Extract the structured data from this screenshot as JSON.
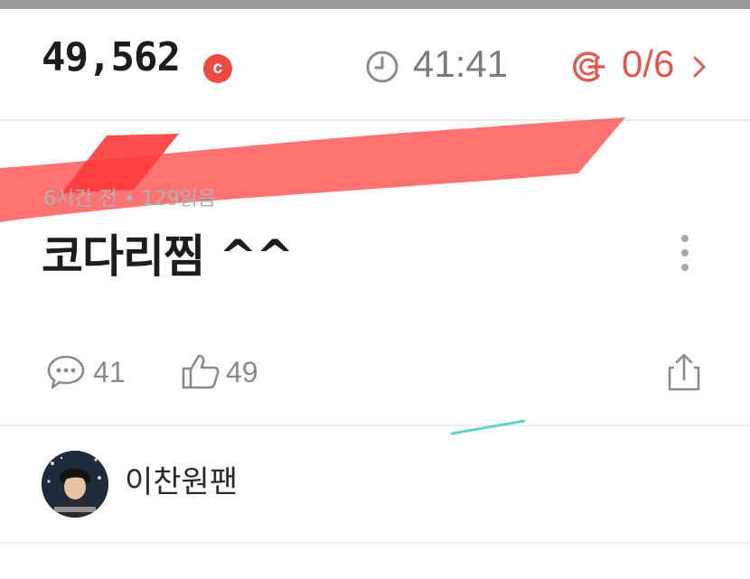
{
  "header": {
    "coin_balance": "49,562",
    "coin_badge_letter": "c",
    "timer": "41:41",
    "quota": "0/6",
    "icons": [
      "coin-icon",
      "clock-icon",
      "coin-plus-icon",
      "chevron-right-icon"
    ]
  },
  "post": {
    "meta": "6시간 전 • 129읽음",
    "title": "코다리찜 ^^",
    "comment_count": "41",
    "like_count": "49",
    "icons": [
      "more-vertical-icon",
      "comment-icon",
      "thumbs-up-icon",
      "share-icon"
    ]
  },
  "author": {
    "name": "이찬원팬"
  },
  "colors": {
    "accent_red": "#ea4b43",
    "quota_red": "#e05a52",
    "scribble_red": "#ff5a5a",
    "icon_gray": "#8a8a8a",
    "text_dark": "#1d1d1d",
    "divider": "#ececec"
  }
}
